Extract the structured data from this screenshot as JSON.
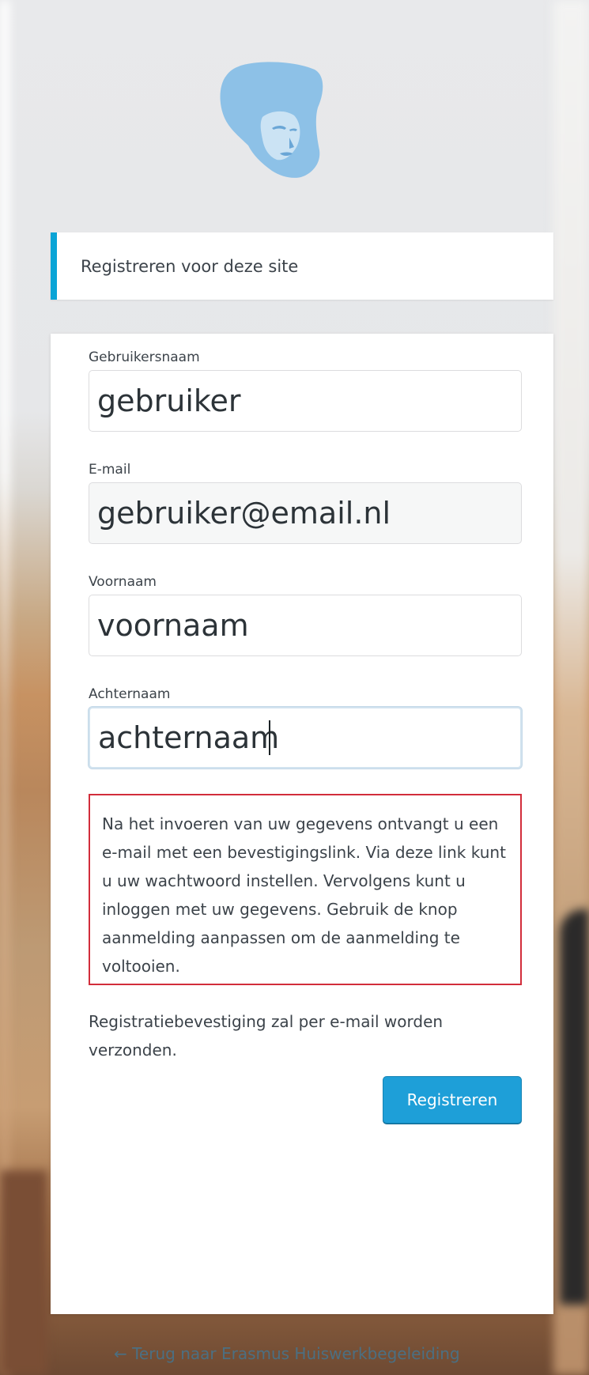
{
  "logo": {
    "icon": "portrait-logo-icon",
    "color": "#8cc0e6"
  },
  "notice": {
    "text": "Registreren voor deze site",
    "accent": "#0aa4d6"
  },
  "form": {
    "username": {
      "label": "Gebruikersnaam",
      "value": "gebruiker"
    },
    "email": {
      "label": "E-mail",
      "value": "gebruiker@email.nl"
    },
    "firstname": {
      "label": "Voornaam",
      "value": "voornaam"
    },
    "lastname": {
      "label": "Achternaam",
      "value": "achternaam"
    },
    "info": "Na het invoeren van uw gegevens ontvangt u een e-mail met een bevestigingslink. Via deze link kunt u uw wachtwoord instellen. Vervolgens kunt u inloggen met uw gegevens. Gebruik de knop aanmelding aanpassen om de aanmelding te voltooien.",
    "confirmation": "Registratiebevestiging zal per e-mail worden verzonden.",
    "submit_label": "Registreren"
  },
  "back_link": "← Terug naar Erasmus Huiswerkbegeleiding",
  "colors": {
    "button": "#1e9fd8",
    "info_border": "#d22d3b",
    "link": "#2a8ac0"
  }
}
